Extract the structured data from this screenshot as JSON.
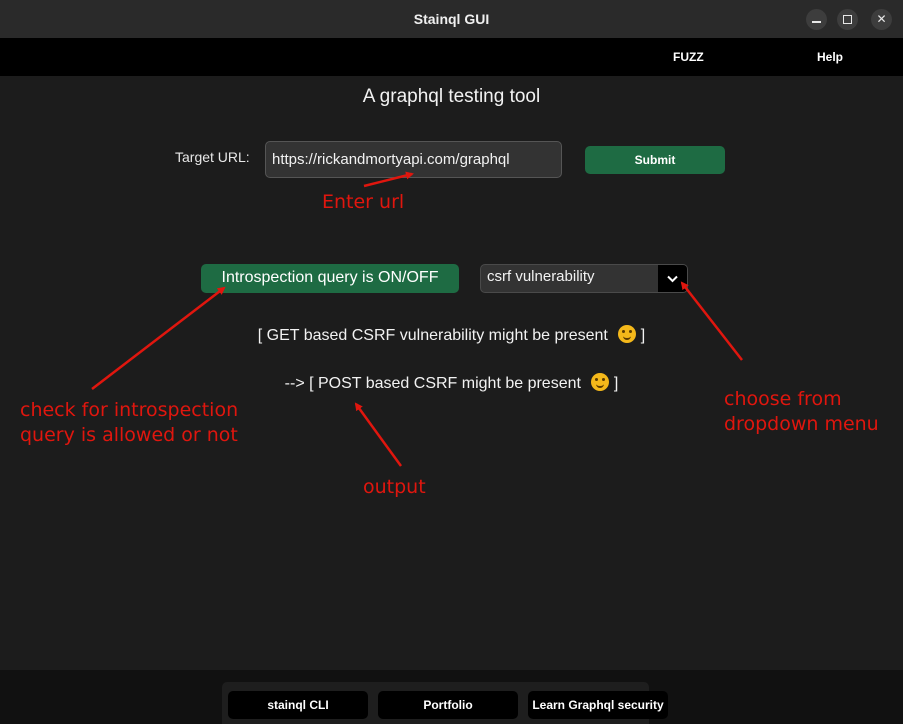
{
  "window": {
    "title": "Stainql GUI",
    "controls": [
      "minimize-icon",
      "maximize-icon",
      "close-icon"
    ]
  },
  "menubar": {
    "items": [
      "FUZZ",
      "Help"
    ]
  },
  "main": {
    "heading": "A graphql testing tool",
    "url_label": "Target URL:",
    "url_value": "https://rickandmortyapi.com/graphql",
    "submit_label": "Submit",
    "introspection_label": "Introspection query is ON/OFF",
    "dropdown_selected": "csrf vulnerability",
    "results": [
      "[ GET based CSRF vulnerability might be present",
      "--> [ POST based CSRF might be present"
    ],
    "results_suffix": "]"
  },
  "annotations": {
    "url": "Enter url",
    "introspection_line1": "check for introspection",
    "introspection_line2": "query is allowed or not",
    "dropdown_line1": "choose from",
    "dropdown_line2": "dropdown menu",
    "output": "output",
    "color": "#e0160e"
  },
  "footer": {
    "buttons": [
      "stainql CLI",
      "Portfolio",
      "Learn Graphql security"
    ]
  },
  "colors": {
    "accent_green": "#1e6b43",
    "background": "#1c1c1c",
    "emoji": "hugging-face-icon"
  }
}
